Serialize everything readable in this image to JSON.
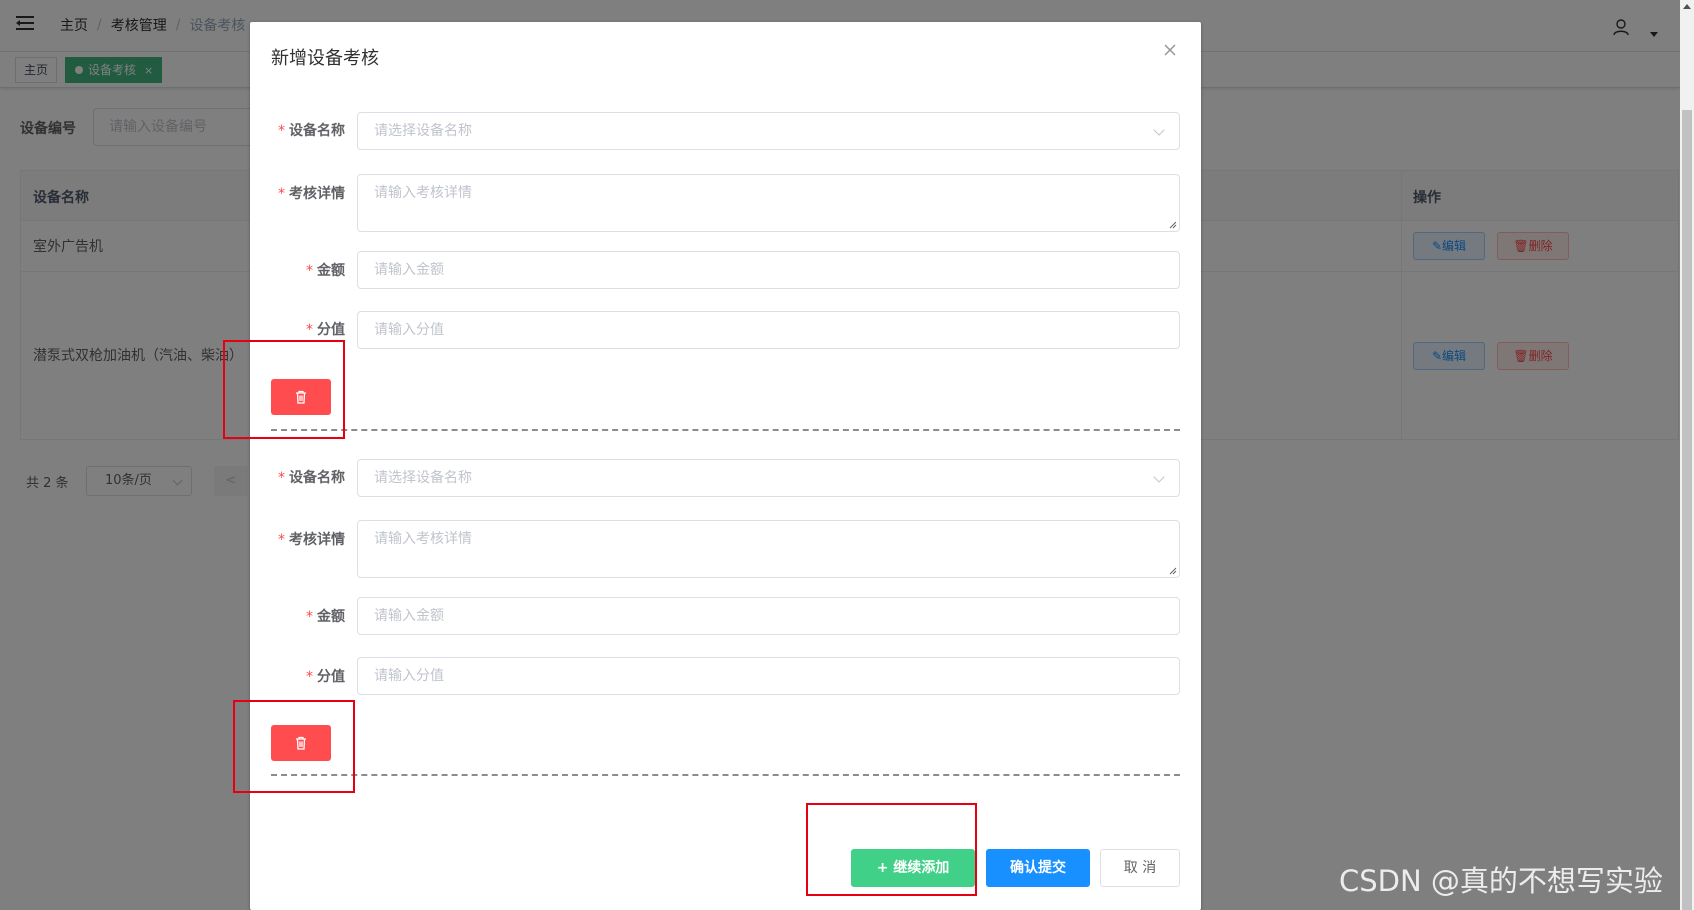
{
  "navbar": {
    "breadcrumb": [
      "主页",
      "考核管理",
      "设备考核"
    ],
    "breadcrumb_sep": "/"
  },
  "tags": [
    {
      "label": "主页",
      "active": false
    },
    {
      "label": "设备考核",
      "active": true,
      "close": "×"
    }
  ],
  "search": {
    "label": "设备编号",
    "placeholder": "请输入设备编号"
  },
  "table": {
    "columns": [
      "设备名称",
      "操作"
    ],
    "rows": [
      {
        "name": "室外广告机",
        "edit_label": "编辑",
        "delete_label": "删除"
      },
      {
        "name": "潜泵式双枪加油机（汽油、柴油）",
        "edit_label": "编辑",
        "delete_label": "删除"
      }
    ]
  },
  "pagination": {
    "total": "共 2 条",
    "page_size": "10条/页",
    "prev": "<"
  },
  "dialog": {
    "title": "新增设备考核",
    "close": "×",
    "groups": [
      {
        "device_label": "设备名称",
        "device_placeholder": "请选择设备名称",
        "detail_label": "考核详情",
        "detail_placeholder": "请输入考核详情",
        "amount_label": "金额",
        "amount_placeholder": "请输入金额",
        "score_label": "分值",
        "score_placeholder": "请输入分值"
      },
      {
        "device_label": "设备名称",
        "device_placeholder": "请选择设备名称",
        "detail_label": "考核详情",
        "detail_placeholder": "请输入考核详情",
        "amount_label": "金额",
        "amount_placeholder": "请输入金额",
        "score_label": "分值",
        "score_placeholder": "请输入分值"
      }
    ],
    "required_mark": "*",
    "buttons": {
      "add": "+ 继续添加",
      "submit": "确认提交",
      "cancel": "取 消"
    }
  },
  "watermark": "CSDN @真的不想写实验",
  "colors": {
    "tag_active": "#42b983",
    "danger": "#ff4d4f",
    "primary": "#1890ff",
    "success": "#41d087",
    "highlight_box": "#e60012"
  },
  "icons": [
    "hamburger-icon",
    "user-icon",
    "caret-down-icon",
    "close-icon",
    "chevron-down-icon",
    "trash-icon",
    "edit-icon",
    "delete-icon"
  ]
}
